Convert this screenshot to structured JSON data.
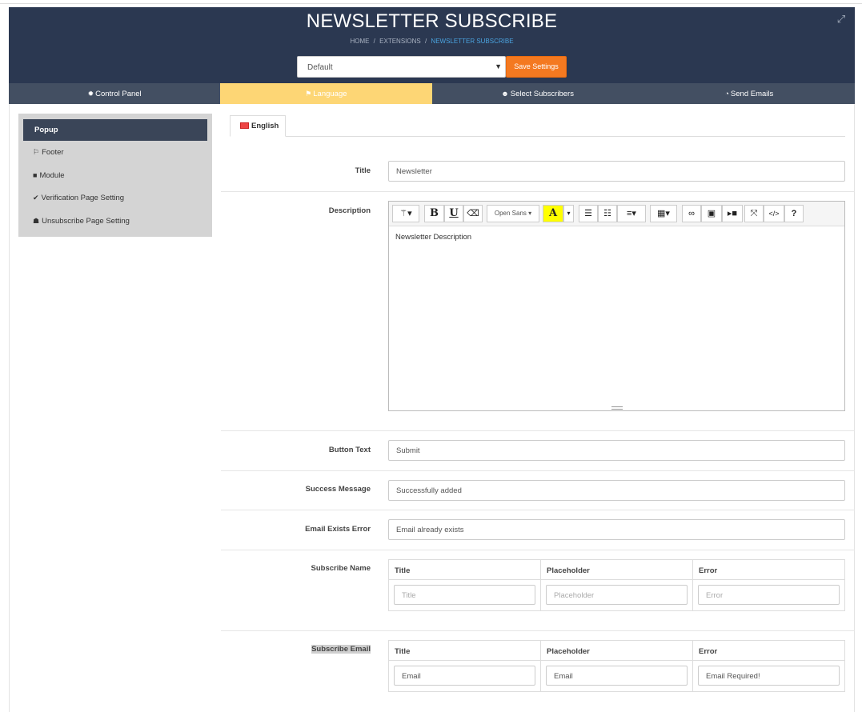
{
  "header": {
    "title": "NEWSLETTER SUBSCRIBE",
    "breadcrumb": [
      "HOME",
      "EXTENSIONS",
      "NEWSLETTER SUBSCRIBE"
    ],
    "store_select": "Default",
    "save_label": "Save Settings"
  },
  "tabs": [
    {
      "label": "Control Panel",
      "icon": "gear-icon"
    },
    {
      "label": "Language",
      "icon": "language-icon",
      "active": true
    },
    {
      "label": "Select Subscribers",
      "icon": "users-icon"
    },
    {
      "label": "Send Emails",
      "icon": "dashboard-icon"
    }
  ],
  "sidebar": {
    "items": [
      {
        "label": "Popup",
        "active": true
      },
      {
        "label": "Footer",
        "icon": "flag-icon"
      },
      {
        "label": "Module",
        "icon": "folder-icon"
      },
      {
        "label": "Verification Page Setting",
        "icon": "check-icon"
      },
      {
        "label": "Unsubscribe Page Setting",
        "icon": "user-remove-icon"
      }
    ]
  },
  "language_tab": "English",
  "form": {
    "title_label": "Title",
    "title_value": "Newsletter",
    "description_label": "Description",
    "description_value": "Newsletter Description",
    "editor_font": "Open Sans",
    "button_text_label": "Button Text",
    "button_text_value": "Submit",
    "success_label": "Success Message",
    "success_value": "Successfully added",
    "email_exists_label": "Email Exists Error",
    "email_exists_value": "Email already exists",
    "subscribe_name": {
      "label": "Subscribe Name",
      "headers": [
        "Title",
        "Placeholder",
        "Error"
      ],
      "placeholders": [
        "Title",
        "Placeholder",
        "Error"
      ]
    },
    "subscribe_email": {
      "label": "Subscribe Email",
      "headers": [
        "Title",
        "Placeholder",
        "Error"
      ],
      "values": [
        "Email",
        "Email",
        "Email Required!"
      ]
    }
  },
  "colors": {
    "header_bg": "#2b3851",
    "tab_bar_bg": "#434f62",
    "active_tab": "#fdd675",
    "save_button": "#f47920",
    "breadcrumb_active": "#4aa3df"
  }
}
